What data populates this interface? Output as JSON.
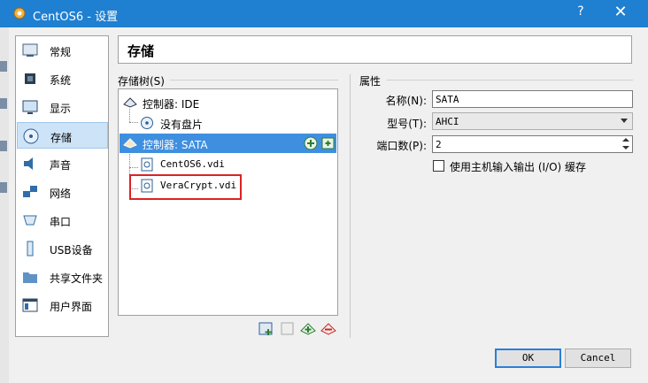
{
  "window": {
    "title": "CentOS6 - 设置",
    "help_label": "?",
    "close_label": "✕"
  },
  "sidebar": {
    "items": [
      {
        "label": "常规",
        "icon": "general-icon"
      },
      {
        "label": "系统",
        "icon": "chip-icon"
      },
      {
        "label": "显示",
        "icon": "monitor-icon"
      },
      {
        "label": "存储",
        "icon": "disk-icon",
        "active": true
      },
      {
        "label": "声音",
        "icon": "speaker-icon"
      },
      {
        "label": "网络",
        "icon": "network-icon"
      },
      {
        "label": "串口",
        "icon": "serial-port-icon"
      },
      {
        "label": "USB设备",
        "icon": "usb-icon"
      },
      {
        "label": "共享文件夹",
        "icon": "folder-icon"
      },
      {
        "label": "用户界面",
        "icon": "ui-icon"
      }
    ]
  },
  "header": {
    "title": "存储"
  },
  "storage_tree": {
    "label": "存储树(S)",
    "rows": [
      {
        "label": "控制器: IDE",
        "type": "controller"
      },
      {
        "label": "没有盘片",
        "type": "optical"
      },
      {
        "label": "控制器: SATA",
        "type": "controller",
        "selected": true
      },
      {
        "label": "CentOS6.vdi",
        "type": "disk"
      },
      {
        "label": "VeraCrypt.vdi",
        "type": "disk",
        "highlighted": true
      }
    ]
  },
  "properties": {
    "label": "属性",
    "name_label": "名称(N):",
    "name_value": "SATA",
    "type_label": "型号(T):",
    "type_value": "AHCI",
    "ports_label": "端口数(P):",
    "ports_value": "2",
    "cache_label": "使用主机输入输出 (I/O) 缓存",
    "cache_checked": false
  },
  "buttons": {
    "ok": "OK",
    "cancel": "Cancel"
  },
  "colors": {
    "titlebar": "#1f7fd1",
    "selection": "#3f8fe0",
    "highlight_box": "#dd2222"
  }
}
